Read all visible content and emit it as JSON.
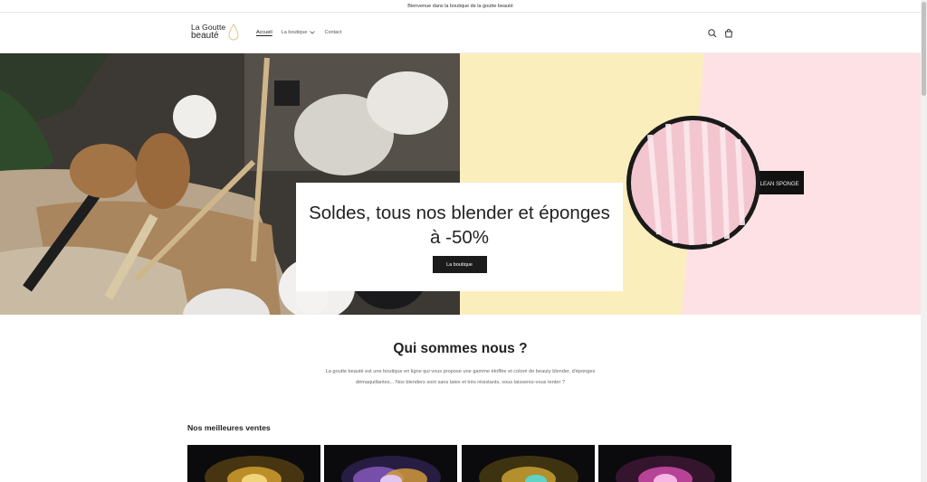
{
  "announcement": "Bienvenue dans la boutique de la goutte beauté",
  "logo": {
    "line1": "La Goutte",
    "line2": "beauté"
  },
  "nav": [
    {
      "label": "Accueil"
    },
    {
      "label": "La boutique"
    },
    {
      "label": "Contact"
    }
  ],
  "hero": {
    "title": "Soldes, tous nos blender et éponges à -50%",
    "button": "La boutique",
    "sponge_tag": "CLEAN SPONGE"
  },
  "about": {
    "title": "Qui sommes nous ?",
    "text": "La goutte beauté est une boutique en ligne qui vous propose une gamme étoffée et coloré de beauty blender, d'éponges démaquillantes... Nos blenders sont sans latex et très résistants, vous laisserez-vous tenter ?"
  },
  "best_sellers": {
    "title": "Nos meilleures ventes"
  },
  "icons": {
    "search": "search-icon",
    "cart": "cart-icon",
    "chevron": "chevron-down-icon",
    "logo_drop": "drop-icon"
  },
  "colors": {
    "button_bg": "#1b1b1b",
    "hero_yellow": "#fbeebd",
    "hero_pink": "#fde1e4"
  }
}
